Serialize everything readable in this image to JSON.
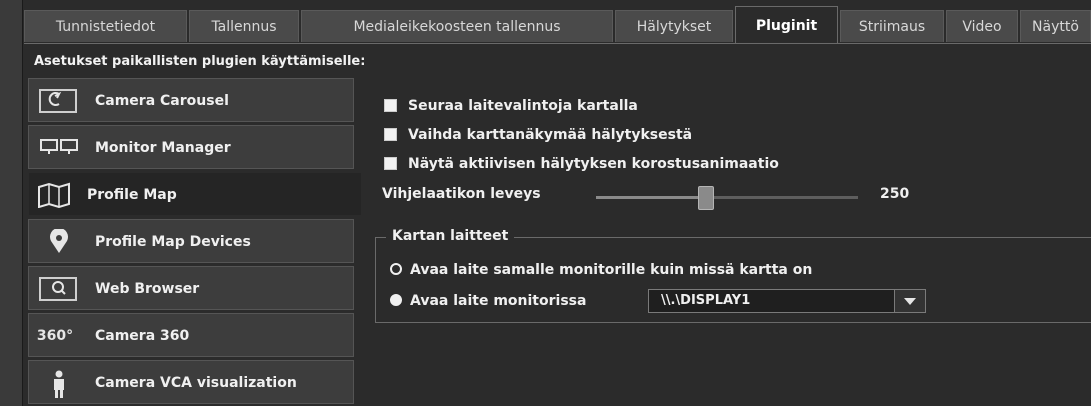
{
  "tabs": [
    {
      "label": "Tunnistetiedot",
      "active": false
    },
    {
      "label": "Tallennus",
      "active": false
    },
    {
      "label": "Medialeikekoosteen tallennus",
      "active": false
    },
    {
      "label": "Hälytykset",
      "active": false
    },
    {
      "label": "Pluginit",
      "active": true
    },
    {
      "label": "Striimaus",
      "active": false
    },
    {
      "label": "Video",
      "active": false
    },
    {
      "label": "Näyttö",
      "active": false
    }
  ],
  "section_title": "Asetukset paikallisten plugien käyttämiselle:",
  "plugins": [
    {
      "label": "Camera Carousel",
      "icon": "carousel-icon",
      "selected": false
    },
    {
      "label": "Monitor Manager",
      "icon": "monitor-icon",
      "selected": false
    },
    {
      "label": "Profile Map",
      "icon": "map-icon",
      "selected": true
    },
    {
      "label": "Profile Map Devices",
      "icon": "map-pin-icon",
      "selected": false
    },
    {
      "label": "Web Browser",
      "icon": "browser-icon",
      "selected": false
    },
    {
      "label": "Camera 360",
      "icon": "camera-360-icon",
      "icon_text": "360°",
      "selected": false
    },
    {
      "label": "Camera VCA visualization",
      "icon": "person-icon",
      "selected": false
    }
  ],
  "settings": {
    "checkboxes": [
      {
        "label": "Seuraa laitevalintoja kartalla",
        "checked": true
      },
      {
        "label": "Vaihda karttanäkymää hälytyksestä",
        "checked": true
      },
      {
        "label": "Näytä aktiivisen hälytyksen korostusanimaatio",
        "checked": true
      }
    ],
    "slider": {
      "label": "Vihjelaatikon leveys",
      "value": "250",
      "fraction": 0.42
    },
    "group": {
      "title": "Kartan laitteet",
      "radio_same_monitor": {
        "label": "Avaa laite samalle monitorille kuin missä kartta on",
        "selected": false
      },
      "radio_monitor": {
        "label": "Avaa laite monitorissa",
        "selected": true
      },
      "monitor_select": {
        "value": "\\\\.\\DISPLAY1"
      }
    }
  },
  "colors": {
    "background": "#2b2b2b",
    "panel": "#3d3d3d",
    "selected": "#252525",
    "text": "#f0f0f0"
  }
}
